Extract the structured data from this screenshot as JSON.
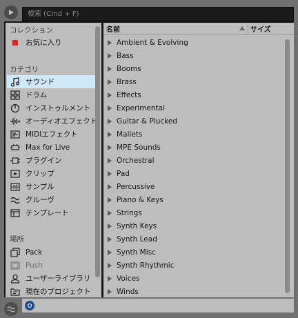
{
  "search": {
    "placeholder": "検索 (Cmd + F)"
  },
  "sidebar": {
    "collections": {
      "heading": "コレクション",
      "items": [
        {
          "label": "お気に入り",
          "icon": "red-square-icon",
          "color": "#e02020"
        }
      ]
    },
    "categories": {
      "heading": "カテゴリ",
      "items": [
        {
          "label": "サウンド",
          "icon": "music-note-icon",
          "selected": true
        },
        {
          "label": "ドラム",
          "icon": "drum-grid-icon"
        },
        {
          "label": "インストゥルメント",
          "icon": "instrument-icon"
        },
        {
          "label": "オーディオエフェクト",
          "icon": "audio-effect-icon"
        },
        {
          "label": "MIDIエフェクト",
          "icon": "midi-effect-icon"
        },
        {
          "label": "Max for Live",
          "icon": "max-for-live-icon"
        },
        {
          "label": "プラグイン",
          "icon": "plugin-icon"
        },
        {
          "label": "クリップ",
          "icon": "clip-icon"
        },
        {
          "label": "サンプル",
          "icon": "sample-icon"
        },
        {
          "label": "グルーヴ",
          "icon": "groove-icon"
        },
        {
          "label": "テンプレート",
          "icon": "template-icon"
        }
      ]
    },
    "places": {
      "heading": "場所",
      "items": [
        {
          "label": "Pack",
          "icon": "pack-icon"
        },
        {
          "label": "Push",
          "icon": "push-icon",
          "dim": true
        },
        {
          "label": "ユーザーライブラリ",
          "icon": "user-library-icon"
        },
        {
          "label": "現在のプロジェクト",
          "icon": "current-project-icon"
        }
      ]
    }
  },
  "list": {
    "columns": {
      "name": "名前",
      "size": "サイズ"
    },
    "rows": [
      "Ambient & Evolving",
      "Bass",
      "Booms",
      "Brass",
      "Effects",
      "Experimental",
      "Guitar & Plucked",
      "Mallets",
      "MPE Sounds",
      "Orchestral",
      "Pad",
      "Percussive",
      "Piano & Keys",
      "Strings",
      "Synth Keys",
      "Synth Lead",
      "Synth Misc",
      "Synth Rhythmic",
      "Voices",
      "Winds"
    ]
  },
  "colors": {
    "selection": "#cfe9f9",
    "panel": "#bdbdbd",
    "background": "#707070",
    "favorite": "#e02020"
  }
}
